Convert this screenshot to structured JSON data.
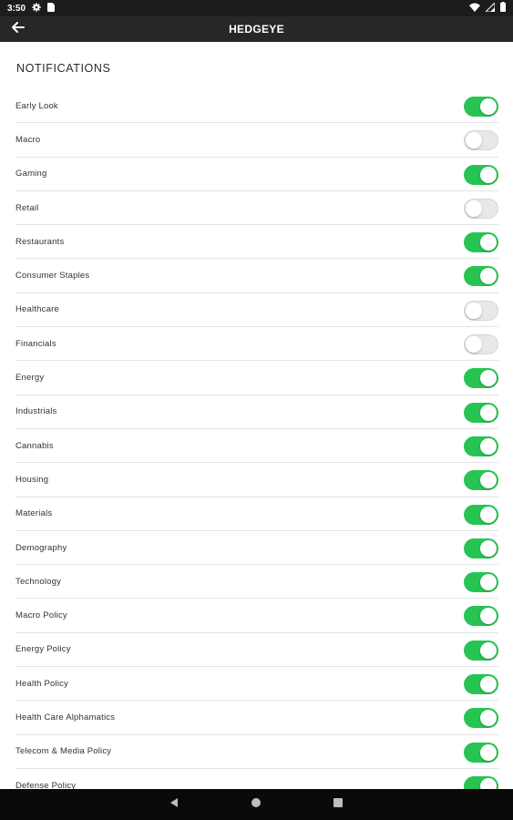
{
  "status_bar": {
    "time": "3:50",
    "icons": [
      "settings-gear-icon",
      "sim-card-icon",
      "wifi-icon",
      "signal-icon",
      "battery-icon"
    ]
  },
  "app_bar": {
    "title": "HEDGEYE",
    "back_icon": "arrow-left-icon"
  },
  "section": {
    "title": "NOTIFICATIONS"
  },
  "colors": {
    "toggle_on": "#27c453",
    "toggle_off": "#e8e8e8",
    "app_bar": "#272727",
    "nav_bar": "#0a0a0a"
  },
  "notifications": [
    {
      "label": "Early Look",
      "enabled": true
    },
    {
      "label": "Macro",
      "enabled": false
    },
    {
      "label": "Gaming",
      "enabled": true
    },
    {
      "label": "Retail",
      "enabled": false
    },
    {
      "label": "Restaurants",
      "enabled": true
    },
    {
      "label": "Consumer Staples",
      "enabled": true
    },
    {
      "label": "Healthcare",
      "enabled": false
    },
    {
      "label": "Financials",
      "enabled": false
    },
    {
      "label": "Energy",
      "enabled": true
    },
    {
      "label": "Industrials",
      "enabled": true
    },
    {
      "label": "Cannabis",
      "enabled": true
    },
    {
      "label": "Housing",
      "enabled": true
    },
    {
      "label": "Materials",
      "enabled": true
    },
    {
      "label": "Demography",
      "enabled": true
    },
    {
      "label": "Technology",
      "enabled": true
    },
    {
      "label": "Macro Policy",
      "enabled": true
    },
    {
      "label": "Energy Policy",
      "enabled": true
    },
    {
      "label": "Health Policy",
      "enabled": true
    },
    {
      "label": "Health Care Alphamatics",
      "enabled": true
    },
    {
      "label": "Telecom & Media Policy",
      "enabled": true
    },
    {
      "label": "Defense Policy",
      "enabled": true
    }
  ],
  "nav_bar": {
    "icons": [
      "back-triangle-icon",
      "home-circle-icon",
      "recents-square-icon"
    ]
  }
}
